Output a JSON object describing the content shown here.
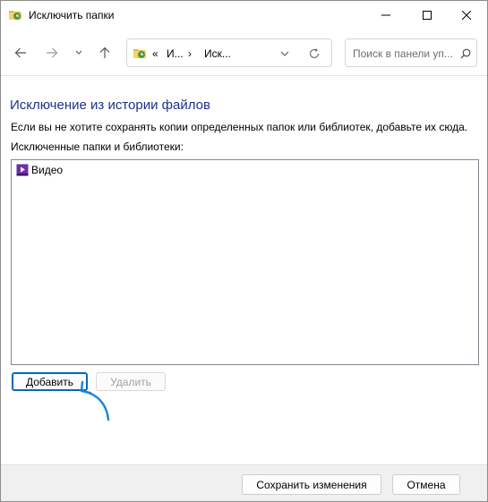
{
  "window": {
    "title": "Исключить папки"
  },
  "navbar": {
    "address": {
      "overflow_label": "«",
      "crumb_1": "И...",
      "separator": "›",
      "crumb_2": "Иск..."
    },
    "search": {
      "placeholder": "Поиск в панели уп..."
    }
  },
  "content": {
    "heading": "Исключение из истории файлов",
    "description": "Если вы не хотите сохранять копии определенных папок или библиотек, добавьте их сюда.",
    "list_label": "Исключенные папки и библиотеки:",
    "items": [
      {
        "label": "Видео",
        "icon": "video-library-icon"
      }
    ],
    "add_button": "Добавить",
    "remove_button": "Удалить"
  },
  "footer": {
    "save_button": "Сохранить изменения",
    "cancel_button": "Отмена"
  },
  "colors": {
    "heading": "#1e3287",
    "accent": "#0067c0",
    "video_icon": "#6e2fa8"
  }
}
